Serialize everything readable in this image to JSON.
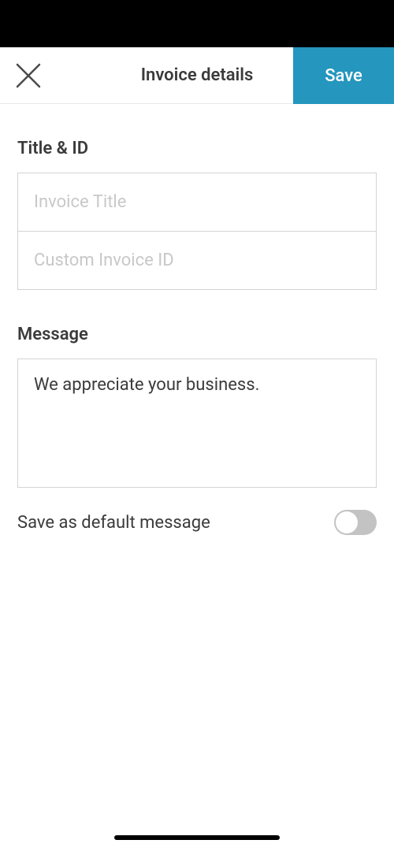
{
  "header": {
    "title": "Invoice details",
    "save_label": "Save"
  },
  "sections": {
    "title_id": {
      "label": "Title & ID",
      "title_placeholder": "Invoice Title",
      "title_value": "",
      "custom_id_placeholder": "Custom Invoice ID",
      "custom_id_value": ""
    },
    "message": {
      "label": "Message",
      "value": "We appreciate your business.",
      "default_toggle_label": "Save as default message",
      "default_toggle_on": false
    }
  }
}
